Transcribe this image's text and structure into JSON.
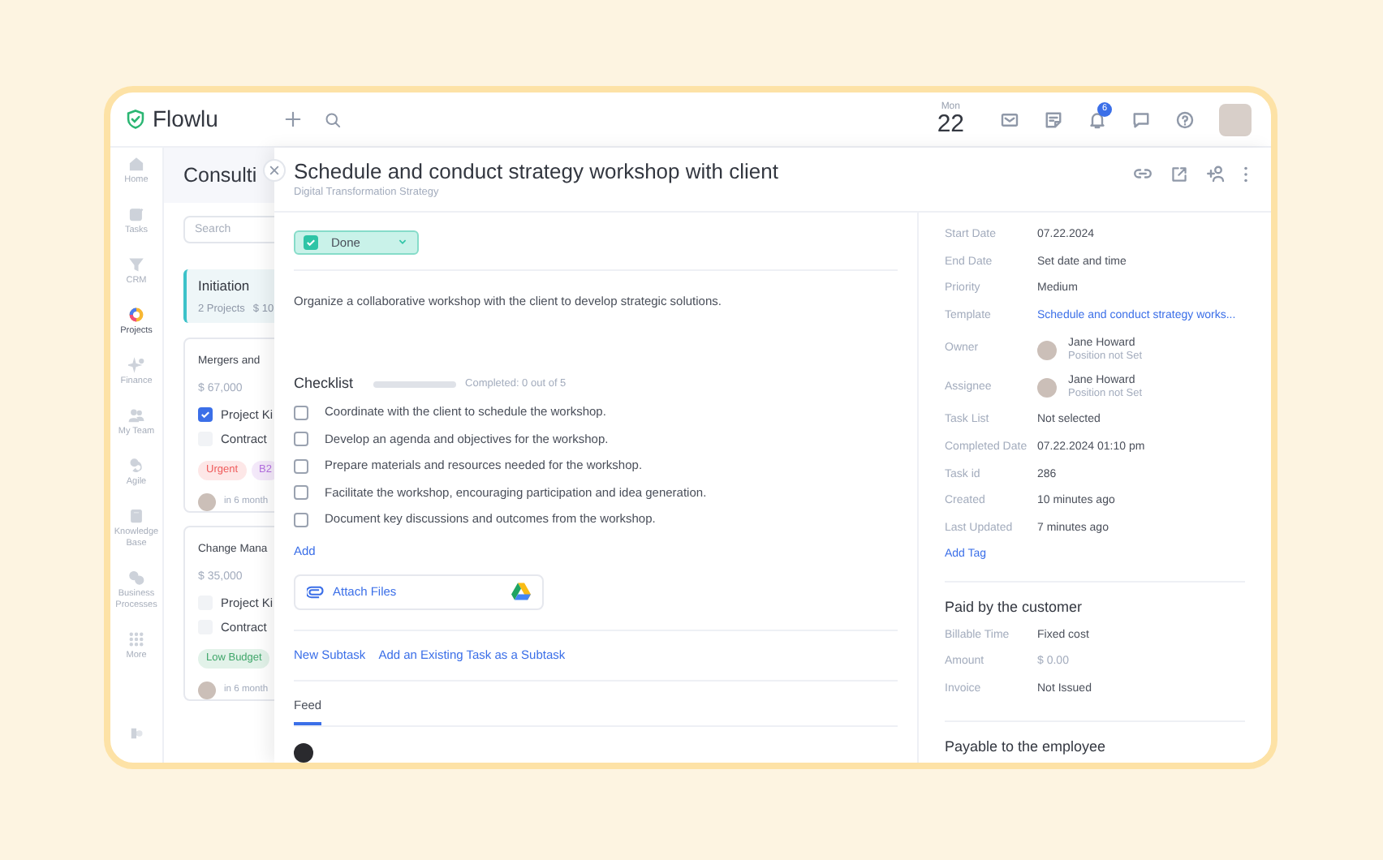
{
  "app": {
    "logo": "Flowlu"
  },
  "top_bar": {
    "weekday": "Mon",
    "day": "22",
    "notification_count": "6"
  },
  "nav": [
    {
      "label": "Home",
      "selected": false
    },
    {
      "label": "Tasks",
      "selected": false
    },
    {
      "label": "CRM",
      "selected": false
    },
    {
      "label": "Projects",
      "selected": true
    },
    {
      "label": "Finance",
      "selected": false
    },
    {
      "label": "My Team",
      "selected": false
    },
    {
      "label": "Agile",
      "selected": false
    },
    {
      "label": "Knowledge Base",
      "selected": false
    },
    {
      "label": "Business Processes",
      "selected": false
    },
    {
      "label": "More",
      "selected": false
    }
  ],
  "board": {
    "title": "Consulti",
    "search": {
      "placeholder": "Search"
    },
    "stage": {
      "name": "Initiation",
      "count": "2 Projects",
      "amount": "$ 10"
    },
    "cards": [
      {
        "title": "Mergers and",
        "amount": "$ 67,000",
        "checklist": [
          {
            "label": "Project Ki",
            "checked": true
          },
          {
            "label": "Contract",
            "checked": false
          }
        ],
        "tags": [
          {
            "label": "Urgent",
            "color": "#ef5b5b"
          },
          {
            "label": "B2",
            "color": "#b46ee0"
          }
        ],
        "due": "in 6 month"
      },
      {
        "title": "Change Mana",
        "amount": "$ 35,000",
        "checklist": [
          {
            "label": "Project Ki",
            "checked": false
          },
          {
            "label": "Contract",
            "checked": false
          }
        ],
        "tags": [
          {
            "label": "Low Budget",
            "color": "#3fa66a"
          }
        ],
        "due": "in 6 month"
      }
    ]
  },
  "task": {
    "title": "Schedule and conduct strategy workshop with client",
    "project": "Digital Transformation Strategy",
    "status": {
      "label": "Done",
      "completed": true
    },
    "description": "Organize a collaborative workshop with the client to develop strategic solutions.",
    "checklist": {
      "title": "Checklist",
      "level": 0,
      "progress": "Completed: 0 out of 5",
      "add": "Add",
      "items": [
        {
          "label": "Coordinate with the client to schedule the workshop.",
          "checked": false
        },
        {
          "label": "Develop an agenda and objectives for the workshop.",
          "checked": false
        },
        {
          "label": "Prepare materials and resources needed for the workshop.",
          "checked": false
        },
        {
          "label": "Facilitate the workshop, encouraging participation and idea generation.",
          "checked": false
        },
        {
          "label": "Document key discussions and outcomes from the workshop.",
          "checked": false
        }
      ]
    },
    "attach": "Attach Files",
    "subtask_links": [
      "New Subtask",
      "Add an Existing Task as a Subtask"
    ],
    "tabs": [
      {
        "label": "Feed",
        "selected": true
      }
    ]
  },
  "details": {
    "fields": [
      {
        "label": "Start Date",
        "value": "07.22.2024",
        "kind": "text"
      },
      {
        "label": "End Date",
        "value": "Set date and time",
        "kind": "text"
      },
      {
        "label": "Priority",
        "value": "Medium",
        "kind": "text"
      },
      {
        "label": "Template",
        "value": "Schedule and conduct strategy works...",
        "kind": "link"
      },
      {
        "label": "Owner",
        "value": "Jane Howard",
        "position": "Position not Set",
        "kind": "person"
      },
      {
        "label": "Assignee",
        "value": "Jane Howard",
        "position": "Position not Set",
        "kind": "person"
      },
      {
        "label": "Task List",
        "value": "Not selected",
        "kind": "text"
      },
      {
        "label": "Completed Date",
        "value": "07.22.2024 01:10 pm",
        "kind": "text"
      },
      {
        "label": "Task id",
        "value": "286",
        "kind": "text"
      },
      {
        "label": "Created",
        "value": "10 minutes ago",
        "kind": "text"
      },
      {
        "label": "Last Updated",
        "value": "7 minutes ago",
        "kind": "text"
      }
    ],
    "add_tag": "Add Tag",
    "sections": [
      {
        "title": "Paid by the customer",
        "fields": [
          {
            "label": "Billable Time",
            "value": "Fixed cost",
            "kind": "text"
          },
          {
            "label": "Amount",
            "value": "$ 0.00",
            "kind": "muted"
          },
          {
            "label": "Invoice",
            "value": "Not Issued",
            "kind": "text"
          }
        ]
      },
      {
        "title": "Payable to the employee"
      }
    ]
  }
}
